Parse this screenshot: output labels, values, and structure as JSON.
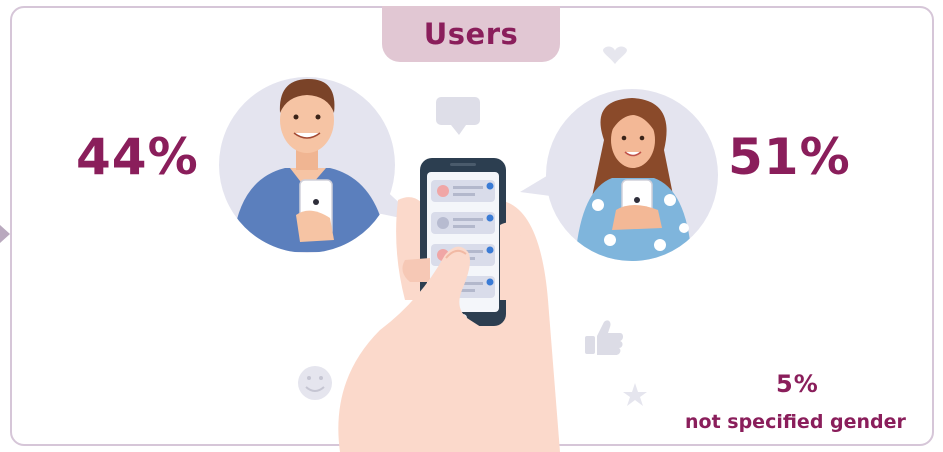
{
  "title": "Users",
  "male": {
    "percent": "44%",
    "icon": "man-with-phone"
  },
  "female": {
    "percent": "51%",
    "icon": "woman-with-phone"
  },
  "unspecified": {
    "percent": "5%",
    "label": "not specified gender"
  },
  "decorations": [
    "heart-icon",
    "chat-bubble-icon",
    "thumbs-up-icon",
    "smiley-icon",
    "star-icon"
  ],
  "colors": {
    "accent": "#8a1e5b",
    "tab": "#e1c7d3",
    "frame": "#d6c6d8",
    "bubble": "#e4e4ef"
  }
}
